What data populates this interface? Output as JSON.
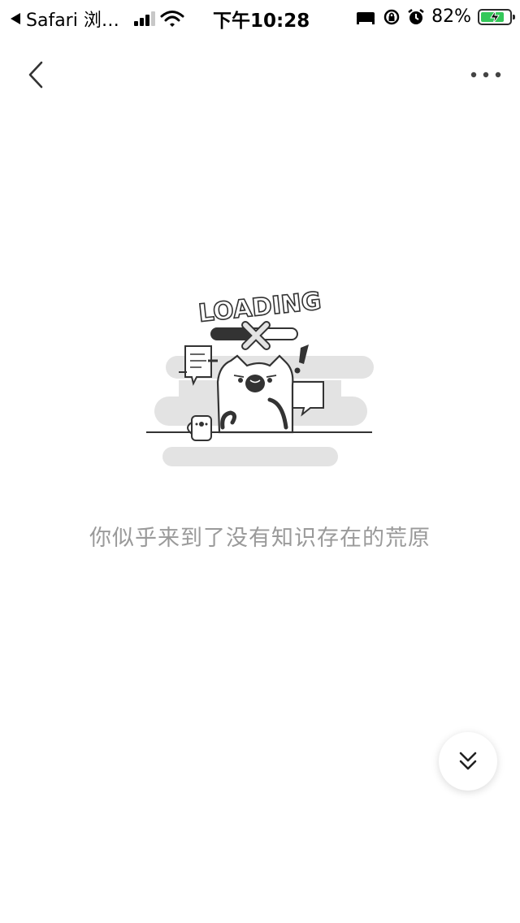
{
  "status_bar": {
    "back_app_label": "Safari 浏…",
    "time": "下午10:28",
    "battery_percent": "82%",
    "battery_level": 0.82,
    "charging": true
  },
  "nav": {
    "back_icon": "chevron-left-icon",
    "more_icon": "more-horizontal-icon"
  },
  "illustration": {
    "heading_text": "LOADING"
  },
  "empty_state": {
    "message": "你似乎来到了没有知识存在的荒原"
  },
  "floating": {
    "icon": "double-chevron-down-icon"
  },
  "colors": {
    "message_text": "#9a9a9a",
    "battery_green": "#34c759",
    "illustration_gray": "#e3e3e3"
  }
}
